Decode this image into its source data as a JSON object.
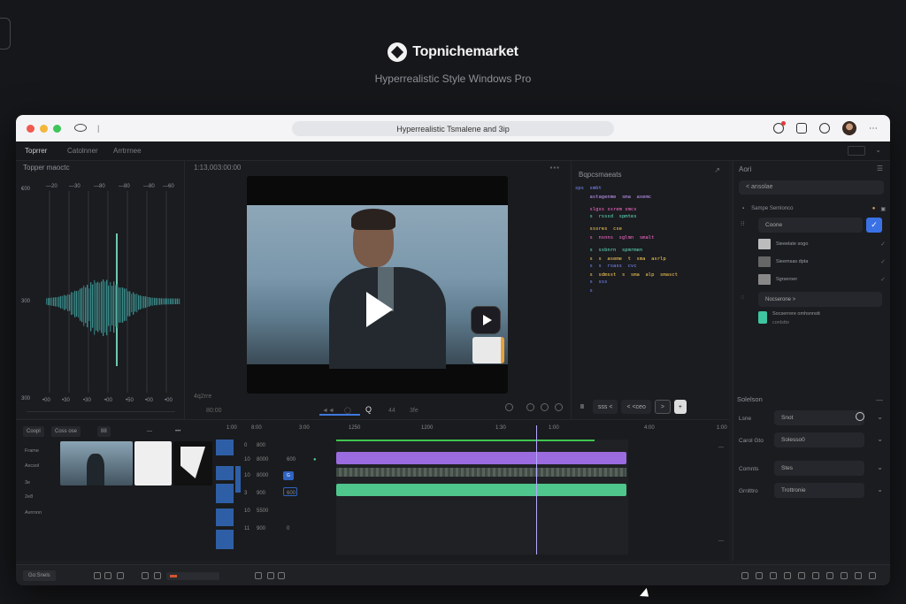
{
  "brand": {
    "name": "Topnichemarket",
    "subtitle": "Hyperrealistic Style Windows Pro"
  },
  "titlebar": {
    "url": "Hyperrealistic Tsmalene and 3ip"
  },
  "tabs": [
    {
      "label": "Toprrer"
    },
    {
      "label": "Catolnner"
    },
    {
      "label": "Arrtrrnee"
    }
  ],
  "waveform": {
    "title": "Topper maoctc",
    "y_labels": [
      "€00",
      "300",
      "300"
    ],
    "x_labels": [
      "•00",
      "•30",
      "•30",
      "•00",
      "•50",
      "•00",
      "•00"
    ],
    "top_labels": [
      "—20",
      "—30",
      "—80",
      "—80",
      "—80",
      "—60",
      "—20"
    ]
  },
  "preview": {
    "timecode": "1:13,003:00:00",
    "controls": [
      "4q2rre",
      "80:00"
    ],
    "bottom_labels": [
      "◄◄",
      "◯",
      "Q",
      "44",
      "3fe"
    ]
  },
  "code": {
    "title": "Bqpcsmaeats",
    "lines": [
      {
        "text": "sps  smbt",
        "color": "#7a8cff"
      },
      {
        "text": "     astagenme  sma  axemc",
        "color": "#c89cff"
      },
      {
        "text": "     slgss ssrem smcs",
        "color": "#ff6bd0"
      },
      {
        "text": "     s  rsssd  spmtes",
        "color": "#5fe0c0"
      },
      {
        "text": "     sssres  cse",
        "color": "#ffcf57"
      },
      {
        "text": "     s  nsnns  sglmn  smalt",
        "color": "#ff6bd0"
      },
      {
        "text": "     s  ssbnrn  spmrmen",
        "color": "#5fe0c0"
      },
      {
        "text": "     s  s  aseme  t  sma  asrlp",
        "color": "#ffcf57"
      },
      {
        "text": "     s  s  rsass  cvc",
        "color": "#7a8cff"
      },
      {
        "text": "     s  sdmsst  s  sma  alp  smasct",
        "color": "#ffcf57"
      },
      {
        "text": "     s  sss",
        "color": "#7a8cff"
      },
      {
        "text": "     s",
        "color": "#7a8cff"
      }
    ],
    "controls": {
      "pause": "II",
      "time": "sss  <",
      "nav": "<  <ceo",
      "next": ">"
    }
  },
  "right_panel": {
    "title": "Aori",
    "search": "< ansolae",
    "row1_label": "Sampe   Semlonco",
    "input1": "Coone",
    "items": [
      {
        "label": "Sieeelate sogo"
      },
      {
        "label": "Sieemsas dpta"
      },
      {
        "label": "Sgrseroer"
      }
    ],
    "collapsed": "Nocserone  >",
    "extra": "Socserrere  omhsnnstt",
    "extra2": "conlstto",
    "section": "Solelson",
    "fields": [
      {
        "label": "Lsne",
        "value": "Snot"
      },
      {
        "label": "Carol Gto",
        "value": "Solesso0"
      },
      {
        "label": "Comnts",
        "value": "Stes"
      },
      {
        "label": "Grnlttro",
        "value": "Trottronie"
      }
    ]
  },
  "timeline": {
    "toolbar": [
      "Coopl",
      "Coss ose",
      "88",
      "—",
      "•••"
    ],
    "media_labels": [
      "Frame",
      "Axcsol",
      "3e",
      "2e8",
      "Avrrnnn"
    ],
    "ruler": [
      "1:00",
      "8:00",
      "3:00",
      "1250",
      "1200",
      "1:30",
      "1:00",
      "4:00",
      "1:00"
    ],
    "track_nums": [
      "0",
      "10",
      "10",
      "3",
      "10",
      "11"
    ],
    "track_names": [
      "800",
      "8000",
      "8000",
      "900",
      "5500",
      "900"
    ],
    "track_tags": [
      "600",
      "600",
      "0"
    ]
  },
  "bottombar": {
    "label": "Go:Snels"
  }
}
